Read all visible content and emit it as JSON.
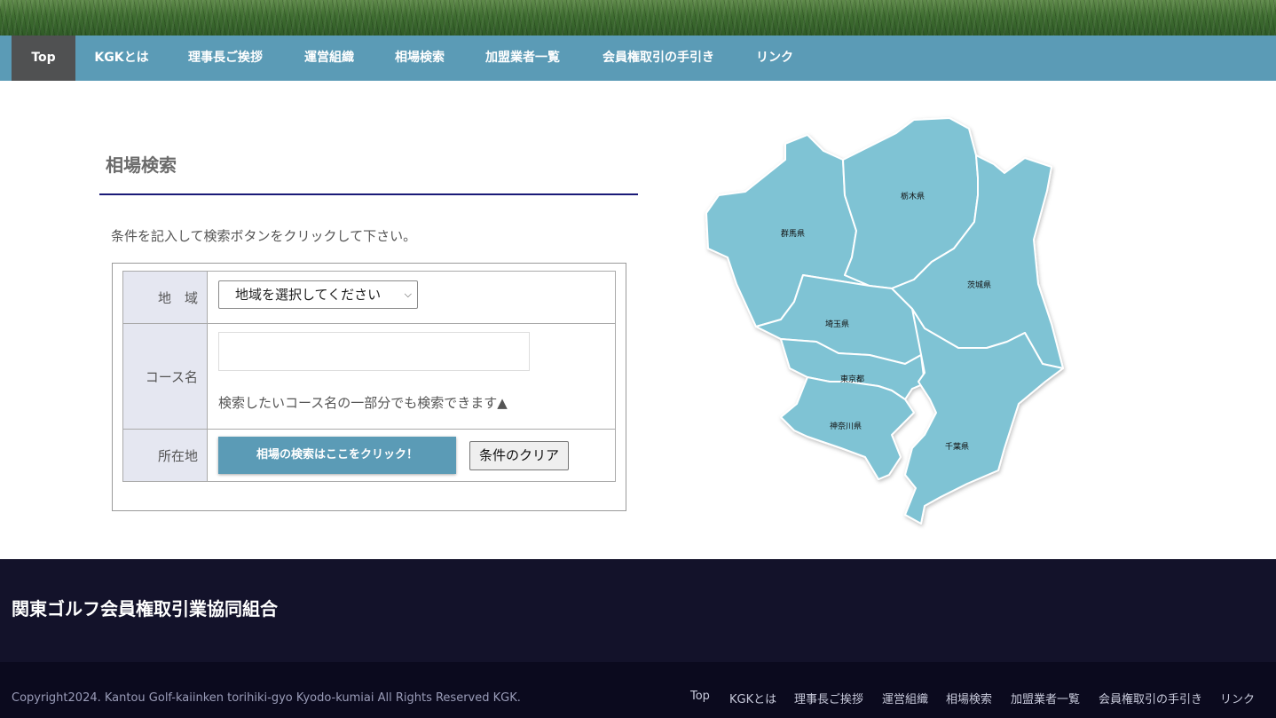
{
  "nav": {
    "items": [
      {
        "label": "Top"
      },
      {
        "label": "KGKとは"
      },
      {
        "label": "理事長ご挨拶"
      },
      {
        "label": "運営組織"
      },
      {
        "label": "相場検索"
      },
      {
        "label": "加盟業者一覧"
      },
      {
        "label": "会員権取引の手引き"
      },
      {
        "label": "リンク"
      }
    ],
    "active": "Top"
  },
  "search": {
    "title": "相場検索",
    "instruction": "条件を記入して検索ボタンをクリックして下さい。",
    "region_label": "地　域",
    "region_selected": "地域を選択してください",
    "course_label": "コース名",
    "course_value": "",
    "course_hint": "検索したいコース名の一部分でも検索できます▲",
    "location_label": "所在地",
    "search_button": "相場の検索はここをクリック！",
    "clear_button": "条件のクリア"
  },
  "map": {
    "prefectures": [
      "群馬県",
      "栃木県",
      "茨城県",
      "埼玉県",
      "東京都",
      "神奈川県",
      "千葉県"
    ]
  },
  "footer": {
    "org_name": "関東ゴルフ会員権取引業協同組合",
    "copyright": "Copyright2024. Kantou Golf-kaiinken torihiki-gyo Kyodo-kumiai All Rights Reserved KGK.",
    "links": [
      "Top",
      "KGKとは",
      "理事長ご挨拶",
      "運営組織",
      "相場検索",
      "加盟業者一覧",
      "会員権取引の手引き",
      "リンク"
    ]
  },
  "colors": {
    "nav_bg": "#5b9bb6",
    "nav_active": "#505152",
    "map_fill": "#7fc3d4",
    "footer_bg": "#13122a",
    "rule": "#1a1a78"
  }
}
